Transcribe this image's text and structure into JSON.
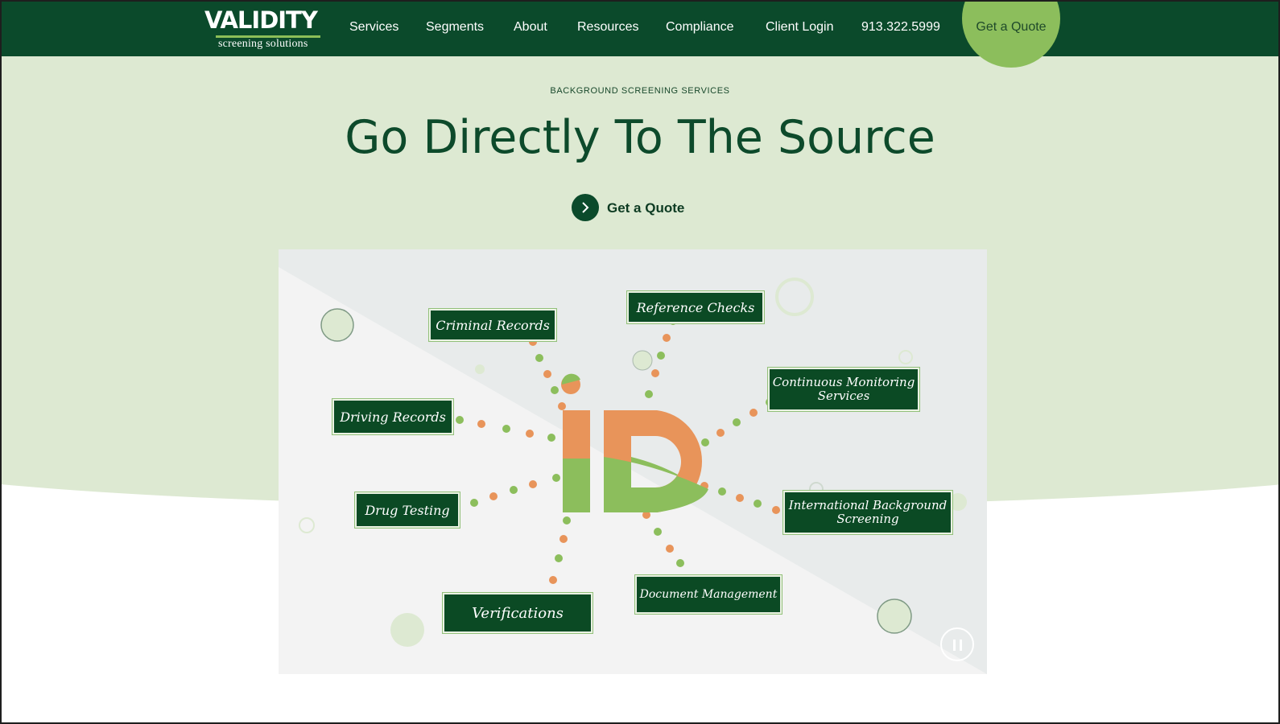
{
  "brand": {
    "name": "VALIDITY",
    "tagline": "screening solutions"
  },
  "nav": {
    "items": [
      "Services",
      "Segments",
      "About",
      "Resources",
      "Compliance",
      "Client Login"
    ],
    "phone": "913.322.5999",
    "quote": "Get a Quote"
  },
  "hero": {
    "eyebrow": "BACKGROUND SCREENING SERVICES",
    "title": "Go Directly To The Source",
    "cta": "Get a Quote"
  },
  "graphic": {
    "center_letters": "ID",
    "labels": [
      "Criminal Records",
      "Reference Checks",
      "Continuous Monitoring Services",
      "Driving Records",
      "Drug Testing",
      "International Background Screening",
      "Document Management",
      "Verifications"
    ]
  },
  "colors": {
    "header": "#0b4a2b",
    "hero_bg": "#dde9d2",
    "accent_green": "#8cbe5c",
    "accent_orange": "#e8945a"
  }
}
